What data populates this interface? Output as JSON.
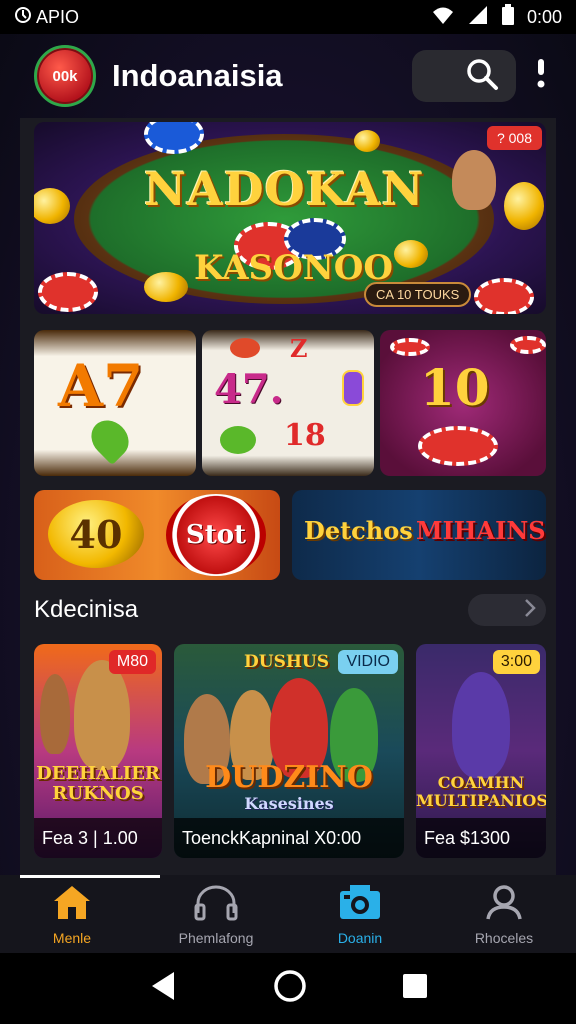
{
  "status_bar": {
    "app_label": "APIO",
    "time": "0:00"
  },
  "header": {
    "logo_text": "00k",
    "title": "Indoanaisia"
  },
  "hero": {
    "title_line1": "NADOKAN",
    "title_line2": "KASONOO",
    "badge": "? 008",
    "pill": "CA 10 TOUKS"
  },
  "slots": {
    "reel1": "A7",
    "reel2_top": "47.",
    "reel2_sym": "Z",
    "reel2_bottom": "18",
    "reel3": "10"
  },
  "promos": {
    "coin_value": "40",
    "chip_label": "Stot",
    "banner_left": "Detchos",
    "banner_right": "MIHAINS"
  },
  "section": {
    "title": "Kdecinisa"
  },
  "cards": [
    {
      "tag": "M80",
      "title": "DEEHALIER RUKNOS",
      "footer": "Fea 3 | 1.00",
      "tag_bg": "#e02828"
    },
    {
      "tag": "VIDIO",
      "top_label": "DUSHUS",
      "title": "DUDZINO",
      "subtitle": "Kasesines",
      "footer": "ToenckKapninal X0:00",
      "tag_bg": "#7ad0f0"
    },
    {
      "tag": "3:00",
      "title": "COAMHN MULTIPANIOS",
      "footer": "Fea $1300",
      "tag_bg": "#ffd23d"
    }
  ],
  "bottom_nav": [
    {
      "label": "Menle",
      "icon": "home-icon"
    },
    {
      "label": "Phemlafong",
      "icon": "headphones-icon"
    },
    {
      "label": "Doanin",
      "icon": "camera-icon"
    },
    {
      "label": "Rhoceles",
      "icon": "profile-icon"
    }
  ],
  "colors": {
    "accent": "#f5a623",
    "active_blue": "#2ab0e8",
    "background": "#1b1b22"
  }
}
